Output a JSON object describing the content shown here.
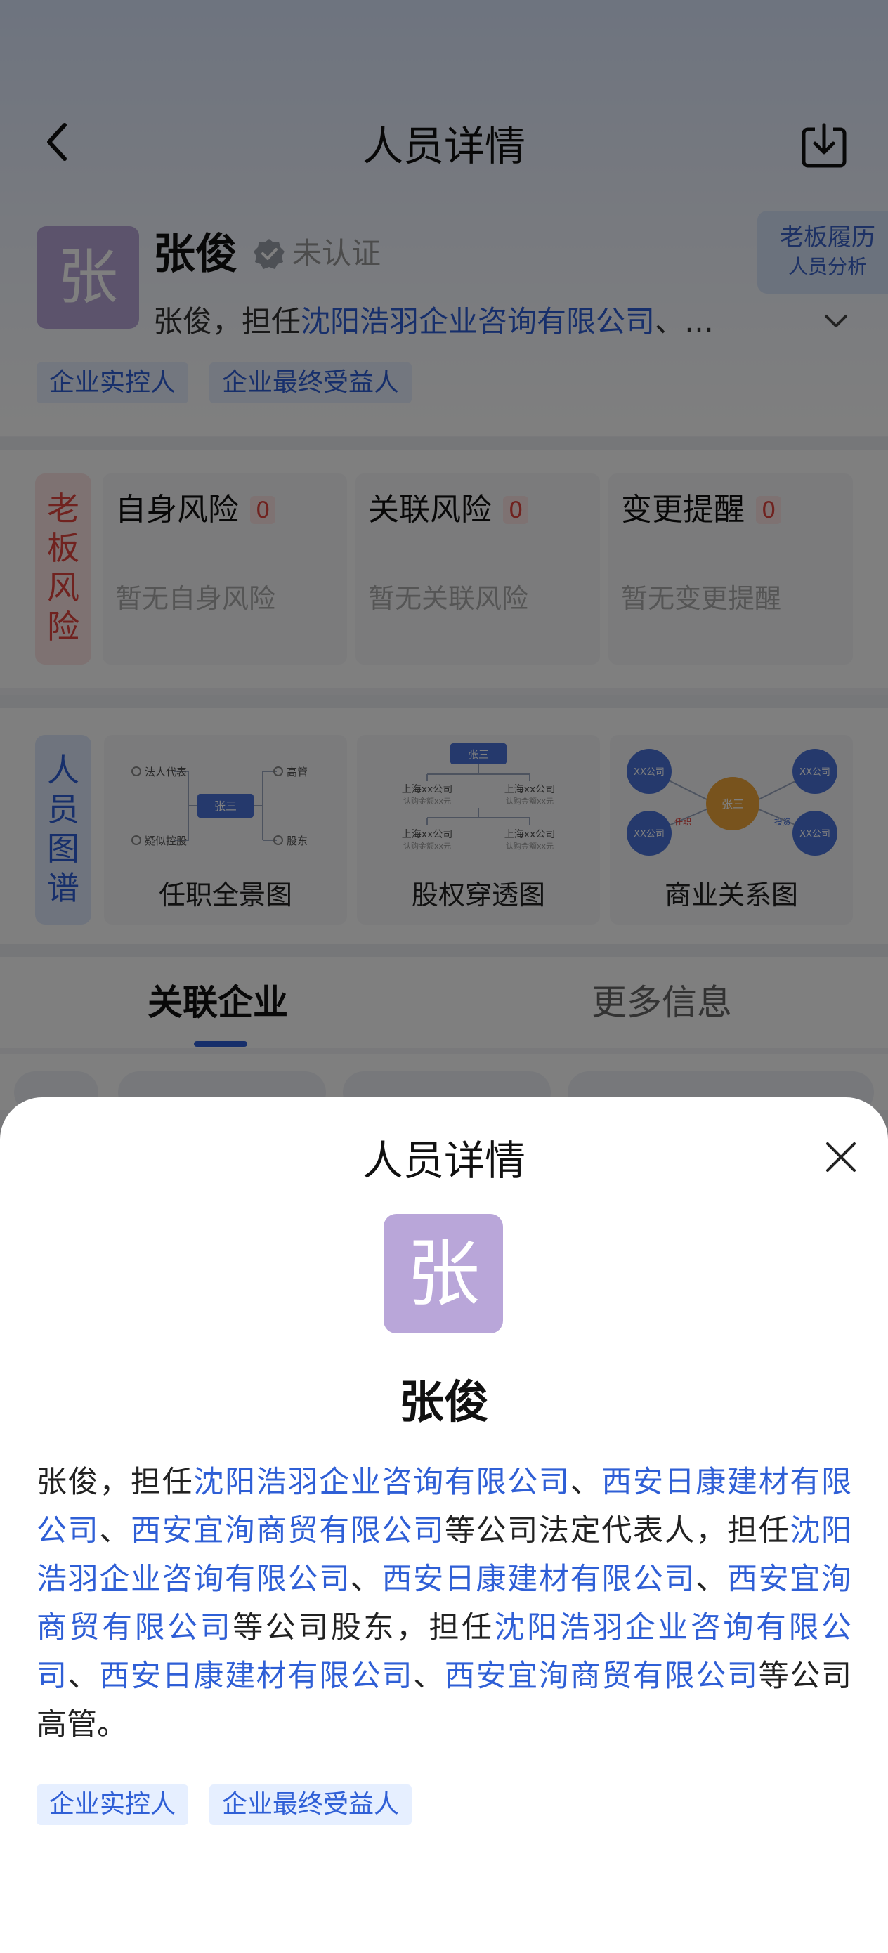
{
  "nav": {
    "title": "人员详情"
  },
  "person": {
    "avatar_char": "张",
    "name": "张俊",
    "verify_status": "未认证",
    "summary_prefix": "张俊，担任",
    "summary_link": "沈阳浩羽企业咨询有限公司",
    "summary_suffix": "、…",
    "tags": [
      "企业实控人",
      "企业最终受益人"
    ]
  },
  "boss_card": {
    "line1": "老板履历",
    "line2": "人员分析"
  },
  "risk": {
    "label": "老板风险",
    "cards": [
      {
        "title": "自身风险",
        "count": "0",
        "empty": "暂无自身风险"
      },
      {
        "title": "关联风险",
        "count": "0",
        "empty": "暂无关联风险"
      },
      {
        "title": "变更提醒",
        "count": "0",
        "empty": "暂无变更提醒"
      }
    ]
  },
  "graph": {
    "label": "人员图谱",
    "cards": [
      {
        "title": "任职全景图",
        "center": "张三",
        "items": [
          "法人代表",
          "高管",
          "疑似控股",
          "股东"
        ]
      },
      {
        "title": "股权穿透图",
        "top": "张三",
        "companies": [
          "上海xx公司",
          "上海xx公司",
          "上海xx公司",
          "上海xx公司"
        ],
        "sub": "认购金额xx元",
        "text_count": 4
      },
      {
        "title": "商业关系图",
        "center": "张三",
        "nodes": [
          "XX公司",
          "XX公司",
          "XX公司",
          "XX公司"
        ],
        "edges": [
          "任职",
          "投资"
        ]
      }
    ]
  },
  "tabs": [
    {
      "label": "关联企业",
      "active": true
    },
    {
      "label": "更多信息",
      "active": false
    }
  ],
  "sheet": {
    "title": "人员详情",
    "avatar_char": "张",
    "name": "张俊",
    "description": [
      {
        "t": "张俊，担任",
        "link": false
      },
      {
        "t": "沈阳浩羽企业咨询有限公司",
        "link": true
      },
      {
        "t": "、",
        "link": false
      },
      {
        "t": "西安日康建材有限公司",
        "link": true
      },
      {
        "t": "、",
        "link": false
      },
      {
        "t": "西安宜洵商贸有限公司",
        "link": true
      },
      {
        "t": "等公司法定代表人，担任",
        "link": false
      },
      {
        "t": "沈阳浩羽企业咨询有限公司",
        "link": true
      },
      {
        "t": "、",
        "link": false
      },
      {
        "t": "西安日康建材有限公司",
        "link": true
      },
      {
        "t": "、",
        "link": false
      },
      {
        "t": "西安宜洵商贸有限公司",
        "link": true
      },
      {
        "t": "等公司股东，担任",
        "link": false
      },
      {
        "t": "沈阳浩羽企业咨询有限公司",
        "link": true
      },
      {
        "t": "、",
        "link": false
      },
      {
        "t": "西安日康建材有限公司",
        "link": true
      },
      {
        "t": "、",
        "link": false
      },
      {
        "t": "西安宜洵商贸有限公司",
        "link": true
      },
      {
        "t": "等公司高管。",
        "link": false
      }
    ],
    "tags": [
      "企业实控人",
      "企业最终受益人"
    ]
  },
  "colors": {
    "accent": "#2f5fd6",
    "risk": "#e0453f",
    "avatar": "#b9a6d9"
  }
}
